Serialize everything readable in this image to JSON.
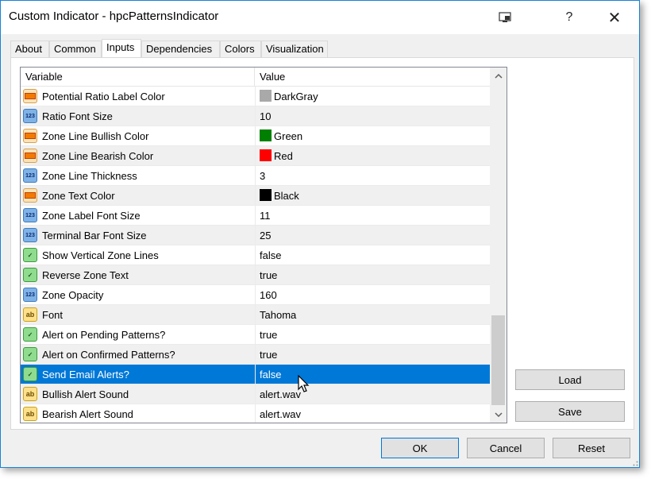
{
  "window": {
    "title": "Custom Indicator - hpcPatternsIndicator",
    "help_label": "?",
    "close_label": "✕"
  },
  "tabs": [
    {
      "label": "About",
      "active": false
    },
    {
      "label": "Common",
      "active": false
    },
    {
      "label": "Inputs",
      "active": true
    },
    {
      "label": "Dependencies",
      "active": false
    },
    {
      "label": "Colors",
      "active": false
    },
    {
      "label": "Visualization",
      "active": false
    }
  ],
  "grid": {
    "headers": {
      "variable": "Variable",
      "value": "Value"
    },
    "rows": [
      {
        "name": "Potential Ratio Label Color",
        "type": "color",
        "value": "DarkGray",
        "swatch": "#a9a9a9"
      },
      {
        "name": "Ratio Font Size",
        "type": "int",
        "value": "10"
      },
      {
        "name": "Zone Line Bullish Color",
        "type": "color",
        "value": "Green",
        "swatch": "#008000"
      },
      {
        "name": "Zone Line Bearish Color",
        "type": "color",
        "value": "Red",
        "swatch": "#ff0000"
      },
      {
        "name": "Zone Line Thickness",
        "type": "int",
        "value": "3"
      },
      {
        "name": "Zone Text Color",
        "type": "color",
        "value": "Black",
        "swatch": "#000000"
      },
      {
        "name": "Zone Label Font Size",
        "type": "int",
        "value": "11"
      },
      {
        "name": "Terminal Bar Font Size",
        "type": "int",
        "value": "25"
      },
      {
        "name": "Show Vertical Zone Lines",
        "type": "bool",
        "value": "false"
      },
      {
        "name": "Reverse Zone Text",
        "type": "bool",
        "value": "true"
      },
      {
        "name": "Zone Opacity",
        "type": "int",
        "value": "160"
      },
      {
        "name": "Font",
        "type": "string",
        "value": "Tahoma"
      },
      {
        "name": "Alert on Pending Patterns?",
        "type": "bool",
        "value": "true"
      },
      {
        "name": "Alert on Confirmed Patterns?",
        "type": "bool",
        "value": "true"
      },
      {
        "name": "Send Email Alerts?",
        "type": "bool",
        "value": "false",
        "selected": true
      },
      {
        "name": "Bullish Alert Sound",
        "type": "string",
        "value": "alert.wav"
      },
      {
        "name": "Bearish Alert Sound",
        "type": "string",
        "value": "alert.wav"
      }
    ],
    "icon_text": {
      "int": "123",
      "bool": "✓",
      "string": "ab"
    }
  },
  "side_buttons": {
    "load": "Load",
    "save": "Save"
  },
  "footer_buttons": {
    "ok": "OK",
    "cancel": "Cancel",
    "reset": "Reset"
  },
  "colors": {
    "selection": "#0078d7",
    "window_border": "#1883d7"
  }
}
